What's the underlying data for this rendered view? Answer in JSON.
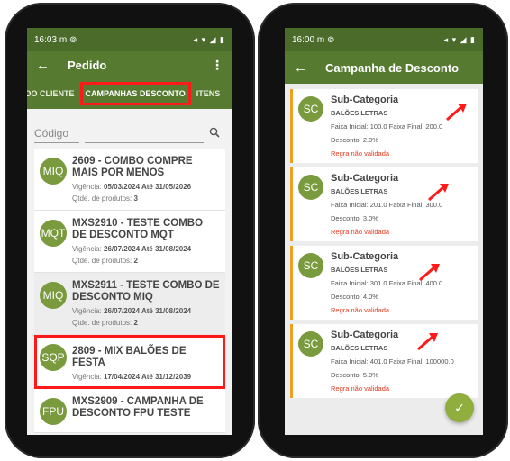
{
  "left": {
    "status": {
      "time": "16:03",
      "carrier": "m",
      "icons": "◂ ▾ ◢ ▮"
    },
    "appbar": {
      "title": "Pedido"
    },
    "tabs": [
      {
        "label": "DO CLIENTE"
      },
      {
        "label": "CAMPANHAS DESCONTO"
      },
      {
        "label": "ITENS"
      }
    ],
    "search": {
      "placeholder": "Código"
    },
    "items": [
      {
        "avatar": "MIQ",
        "title": "2609 - COMBO COMPRE MAIS POR MENOS",
        "vigencia_label": "Vigência:",
        "vigencia": "05/03/2024 Até 31/05/2026",
        "qtd_label": "Qtde. de produtos:",
        "qtd": "3"
      },
      {
        "avatar": "MQT",
        "title": "MXS2910 - TESTE COMBO DE DESCONTO MQT",
        "vigencia_label": "Vigência:",
        "vigencia": "26/07/2024 Até 31/08/2024",
        "qtd_label": "Qtde. de produtos:",
        "qtd": "2"
      },
      {
        "avatar": "MIQ",
        "title": "MXS2911 - TESTE COMBO DE DESCONTO MIQ",
        "vigencia_label": "Vigência:",
        "vigencia": "26/07/2024 Até 31/08/2024",
        "qtd_label": "Qtde. de produtos:",
        "qtd": "2"
      },
      {
        "avatar": "SQP",
        "title": "2809 - MIX BALÕES DE FESTA",
        "vigencia_label": "Vigência:",
        "vigencia": "17/04/2024 Até 31/12/2039"
      },
      {
        "avatar": "FPU",
        "title": "MXS2909 - CAMPANHA DE DESCONTO FPU TESTE"
      }
    ]
  },
  "right": {
    "status": {
      "time": "16:00",
      "carrier": "m",
      "icons": "◂ ▾ ◢ ▮"
    },
    "appbar": {
      "title": "Campanha de Desconto"
    },
    "cards": [
      {
        "avatar": "SC",
        "title": "Sub-Categoria",
        "sub": "BALÕES LETRAS",
        "faixa": "Faixa Inicial: 100.0 Faixa Final: 200.0",
        "desconto": "Desconto: 2.0%",
        "erro": "Regra não validada"
      },
      {
        "avatar": "SC",
        "title": "Sub-Categoria",
        "sub": "BALÕES LETRAS",
        "faixa": "Faixa Inicial: 201.0 Faixa Final: 300.0",
        "desconto": "Desconto: 3.0%",
        "erro": "Regra não validada"
      },
      {
        "avatar": "SC",
        "title": "Sub-Categoria",
        "sub": "BALÕES LETRAS",
        "faixa": "Faixa Inicial: 301.0 Faixa Final: 400.0",
        "desconto": "Desconto: 4.0%",
        "erro": "Regra não validada"
      },
      {
        "avatar": "SC",
        "title": "Sub-Categoria",
        "sub": "BALÕES LETRAS",
        "faixa": "Faixa Inicial: 401.0 Faixa Final: 100000.0",
        "desconto": "Desconto: 5.0%",
        "erro": "Regra não validada"
      }
    ],
    "fab_icon": "check-icon"
  },
  "colors": {
    "primary": "#557a30",
    "statusbar": "#4a6b2a",
    "avatar": "#7a9a3e",
    "highlight": "#ff1a1a",
    "accent_bar": "#f0a020",
    "error_text": "#e53b1f"
  }
}
